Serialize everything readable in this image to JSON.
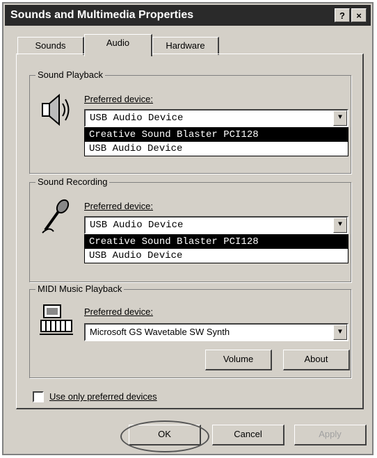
{
  "window": {
    "title": "Sounds and Multimedia Properties",
    "help_btn": "?",
    "close_btn": "×"
  },
  "tabs": [
    {
      "label": "Sounds"
    },
    {
      "label": "Audio",
      "active": true
    },
    {
      "label": "Hardware"
    }
  ],
  "playback": {
    "group_label": "Sound Playback",
    "preferred_label": "Preferred device:",
    "selected": "USB Audio Device",
    "options": [
      "Creative Sound Blaster PCI128",
      "USB Audio Device"
    ]
  },
  "recording": {
    "group_label": "Sound Recording",
    "preferred_label": "Preferred device:",
    "selected": "USB Audio Device",
    "options": [
      "Creative Sound Blaster PCI128",
      "USB Audio Device"
    ]
  },
  "midi": {
    "group_label": "MIDI Music Playback",
    "preferred_label": "Preferred device:",
    "selected": "Microsoft GS Wavetable SW Synth",
    "volume_btn": "Volume",
    "about_btn": "About"
  },
  "use_only_preferred": "Use only preferred devices",
  "footer": {
    "ok": "OK",
    "cancel": "Cancel",
    "apply": "Apply"
  }
}
